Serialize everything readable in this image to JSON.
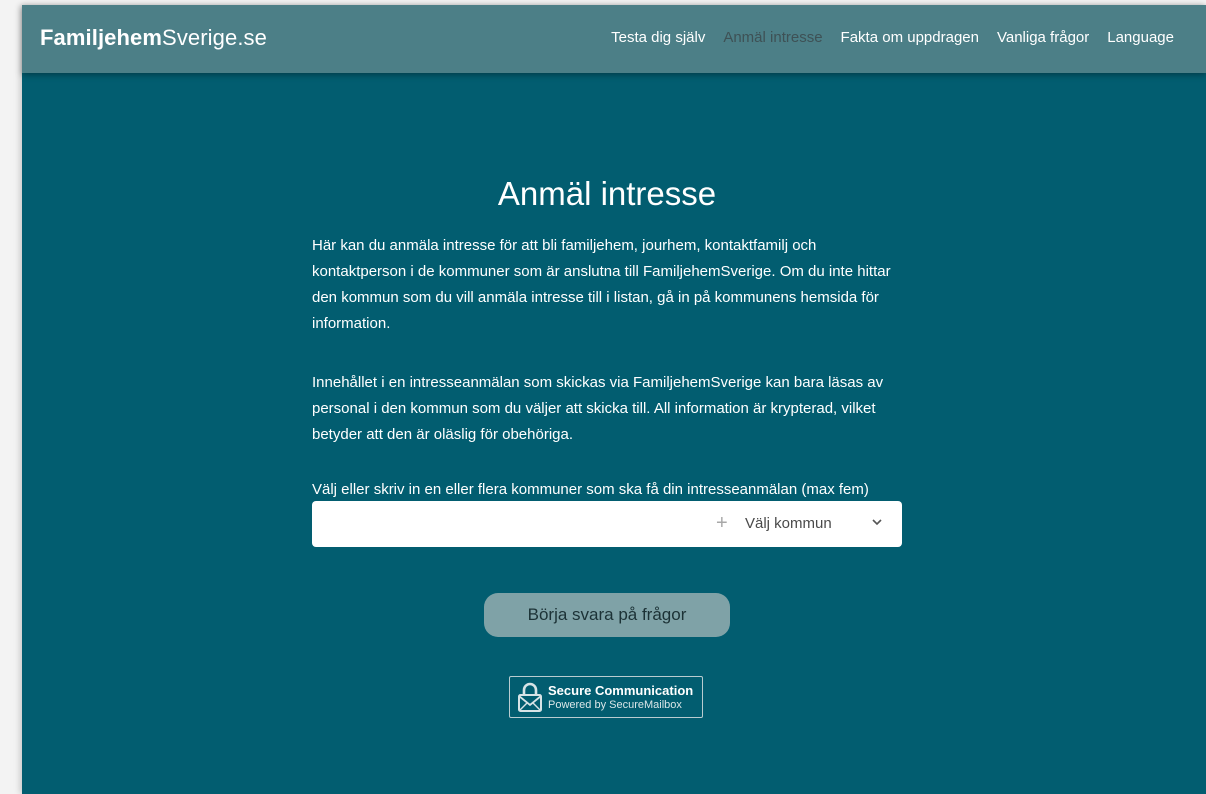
{
  "brand": {
    "bold": "Familjehem",
    "regular": "Sverige.se"
  },
  "nav": {
    "items": [
      {
        "label": "Testa dig själv"
      },
      {
        "label": "Anmäl intresse",
        "active": true
      },
      {
        "label": "Fakta om uppdragen"
      },
      {
        "label": "Vanliga frågor"
      },
      {
        "label": "Language"
      }
    ]
  },
  "main": {
    "title": "Anmäl intresse",
    "paragraph1": "Här kan du anmäla intresse för att bli familjehem, jourhem, kontaktfamilj och kontaktperson i de kommuner som är anslutna till FamiljehemSverige. Om du inte hittar den kommun som du vill anmäla intresse till i listan, gå in på kommunens hemsida för information.",
    "paragraph2": "Innehållet i en intresseanmälan som skickas via FamiljehemSverige kan bara läsas av personal i den kommun som du väljer att skicka till. All information är krypterad, vilket betyder att den är oläslig för obehöriga.",
    "select_label": "Välj eller skriv in en eller flera kommuner som ska få din intresseanmälan (max fem)",
    "select_placeholder": "Välj kommun",
    "start_button": "Börja svara på frågor",
    "badge": {
      "line1": "Secure Communication",
      "line2": "Powered by SecureMailbox"
    }
  },
  "colors": {
    "navbar": "#4c7f87",
    "background": "#025d70",
    "button": "#7fa2a7",
    "active_nav": "#3e5155"
  },
  "icons": {
    "plus": "plus-icon",
    "chevron": "chevron-down-icon",
    "badge": "lock-mail-icon"
  }
}
